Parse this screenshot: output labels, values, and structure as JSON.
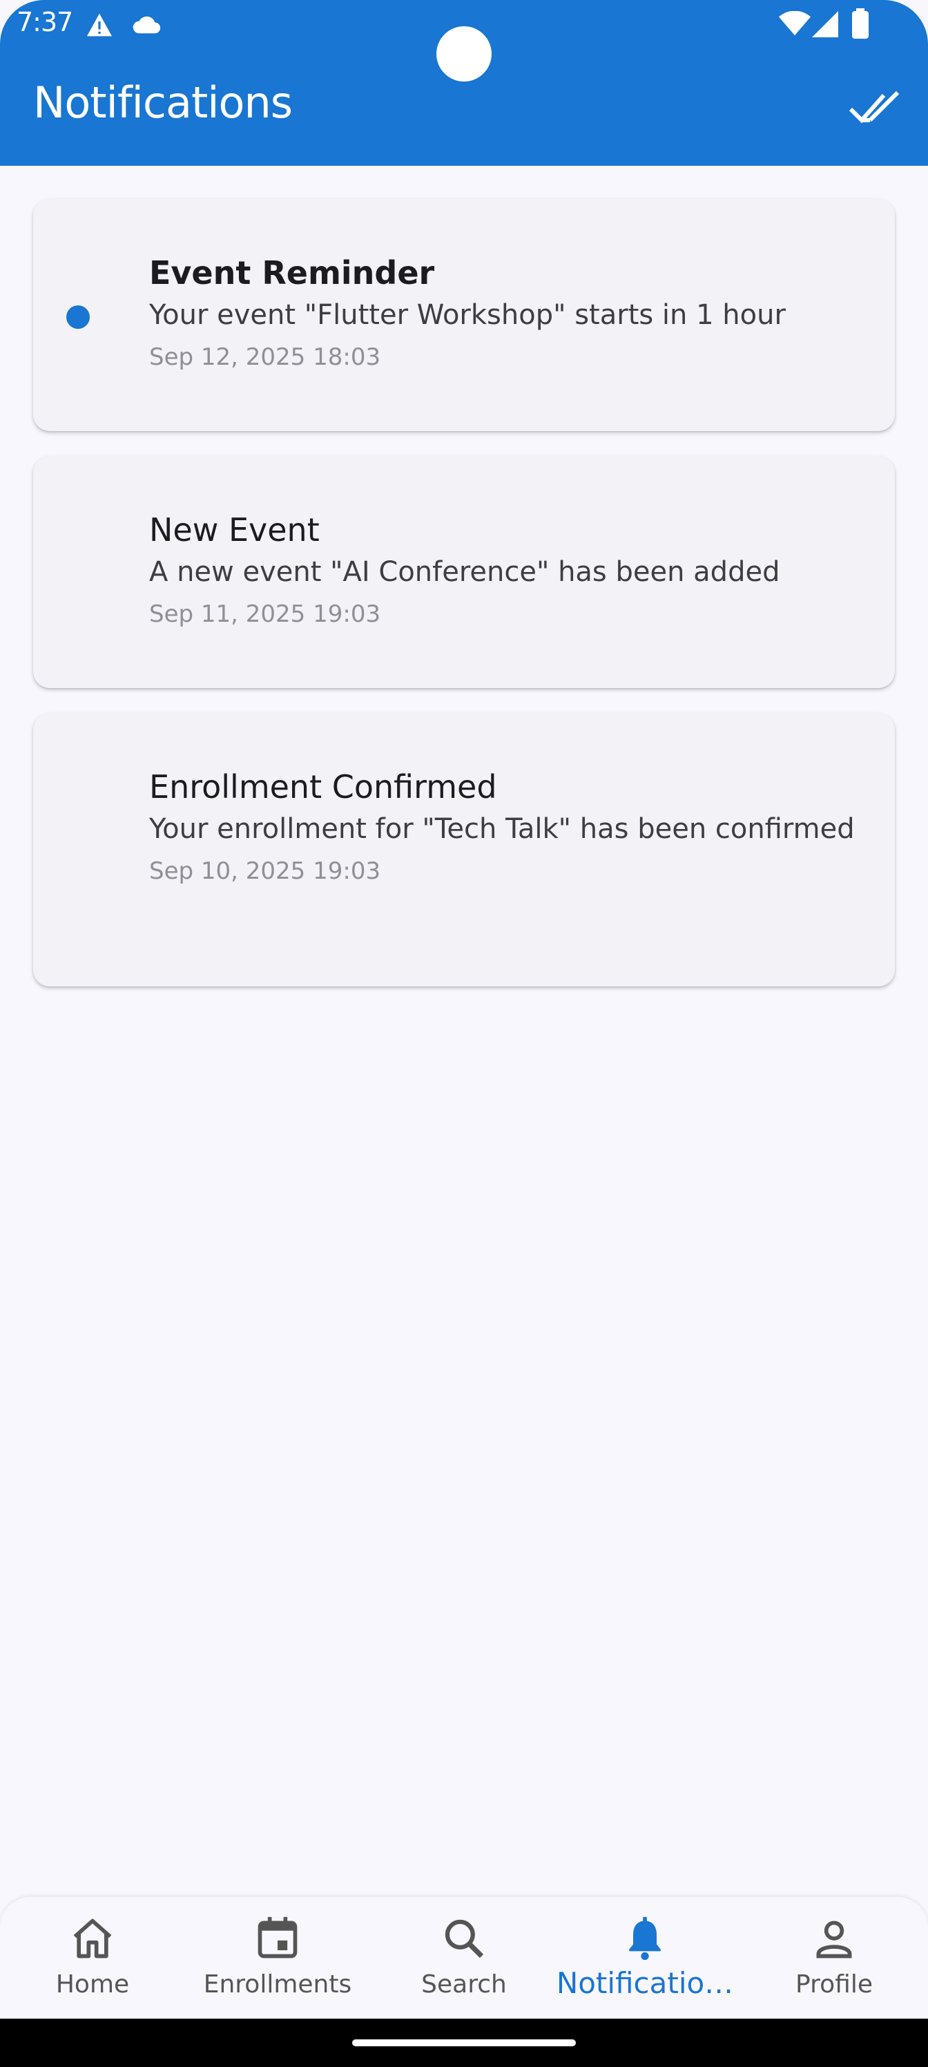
{
  "status_bar": {
    "time": "7:37",
    "icons": [
      "warning-icon",
      "cloud-icon",
      "wifi-icon",
      "signal-icon",
      "battery-icon"
    ]
  },
  "app_bar": {
    "title": "Notifications",
    "action_icon": "double-check-icon"
  },
  "notifications": [
    {
      "title": "Event Reminder",
      "message": "Your event \"Flutter Workshop\" starts in 1 hour",
      "date": "Sep 12, 2025 18:03",
      "unread": true
    },
    {
      "title": "New Event",
      "message": "A new event \"AI Conference\" has been added",
      "date": "Sep 11, 2025 19:03",
      "unread": false
    },
    {
      "title": "Enrollment Confirmed",
      "message": "Your enrollment for \"Tech Talk\" has been confirmed",
      "date": "Sep 10, 2025 19:03",
      "unread": false
    }
  ],
  "bottom_nav": {
    "items": [
      {
        "label": "Home",
        "icon": "home-icon",
        "active": false
      },
      {
        "label": "Enrollments",
        "icon": "calendar-icon",
        "active": false
      },
      {
        "label": "Search",
        "icon": "search-icon",
        "active": false
      },
      {
        "label": "Notificatio…",
        "icon": "bell-icon",
        "active": true
      },
      {
        "label": "Profile",
        "icon": "person-icon",
        "active": false
      }
    ]
  },
  "colors": {
    "primary": "#1976d2",
    "background": "#f8f7fd",
    "card": "#f2f2f7",
    "inactive": "#555555"
  }
}
